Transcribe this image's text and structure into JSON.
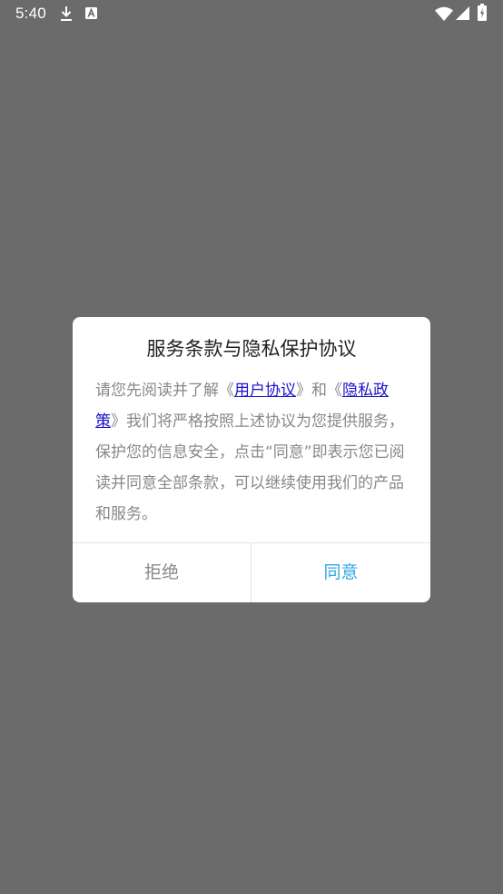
{
  "status_bar": {
    "time": "5:40",
    "left_icons": [
      "download-icon",
      "a-notification-icon"
    ],
    "right_icons": [
      "wifi-icon",
      "cellular-signal-icon",
      "battery-icon"
    ]
  },
  "dialog": {
    "title": "服务条款与隐私保护协议",
    "body": {
      "part1": "请您先阅读并了解《",
      "link_user_agreement": "用户协议",
      "part2": "》和《",
      "link_privacy_policy": "隐私政策",
      "part3": "》我们将严格按照上述协议为您提供服务，保护您的信息安全，点击“同意”即表示您已阅读并同意全部条款，可以继续使用我们的产品和服务。"
    },
    "buttons": {
      "reject": "拒绝",
      "agree": "同意"
    }
  },
  "colors": {
    "overlay": "#6b6b6b",
    "dialog_bg": "#ffffff",
    "title": "#222222",
    "body_text": "#888888",
    "link": "#1a12c8",
    "agree": "#2ea7e0",
    "divider": "#e4e4e4"
  }
}
